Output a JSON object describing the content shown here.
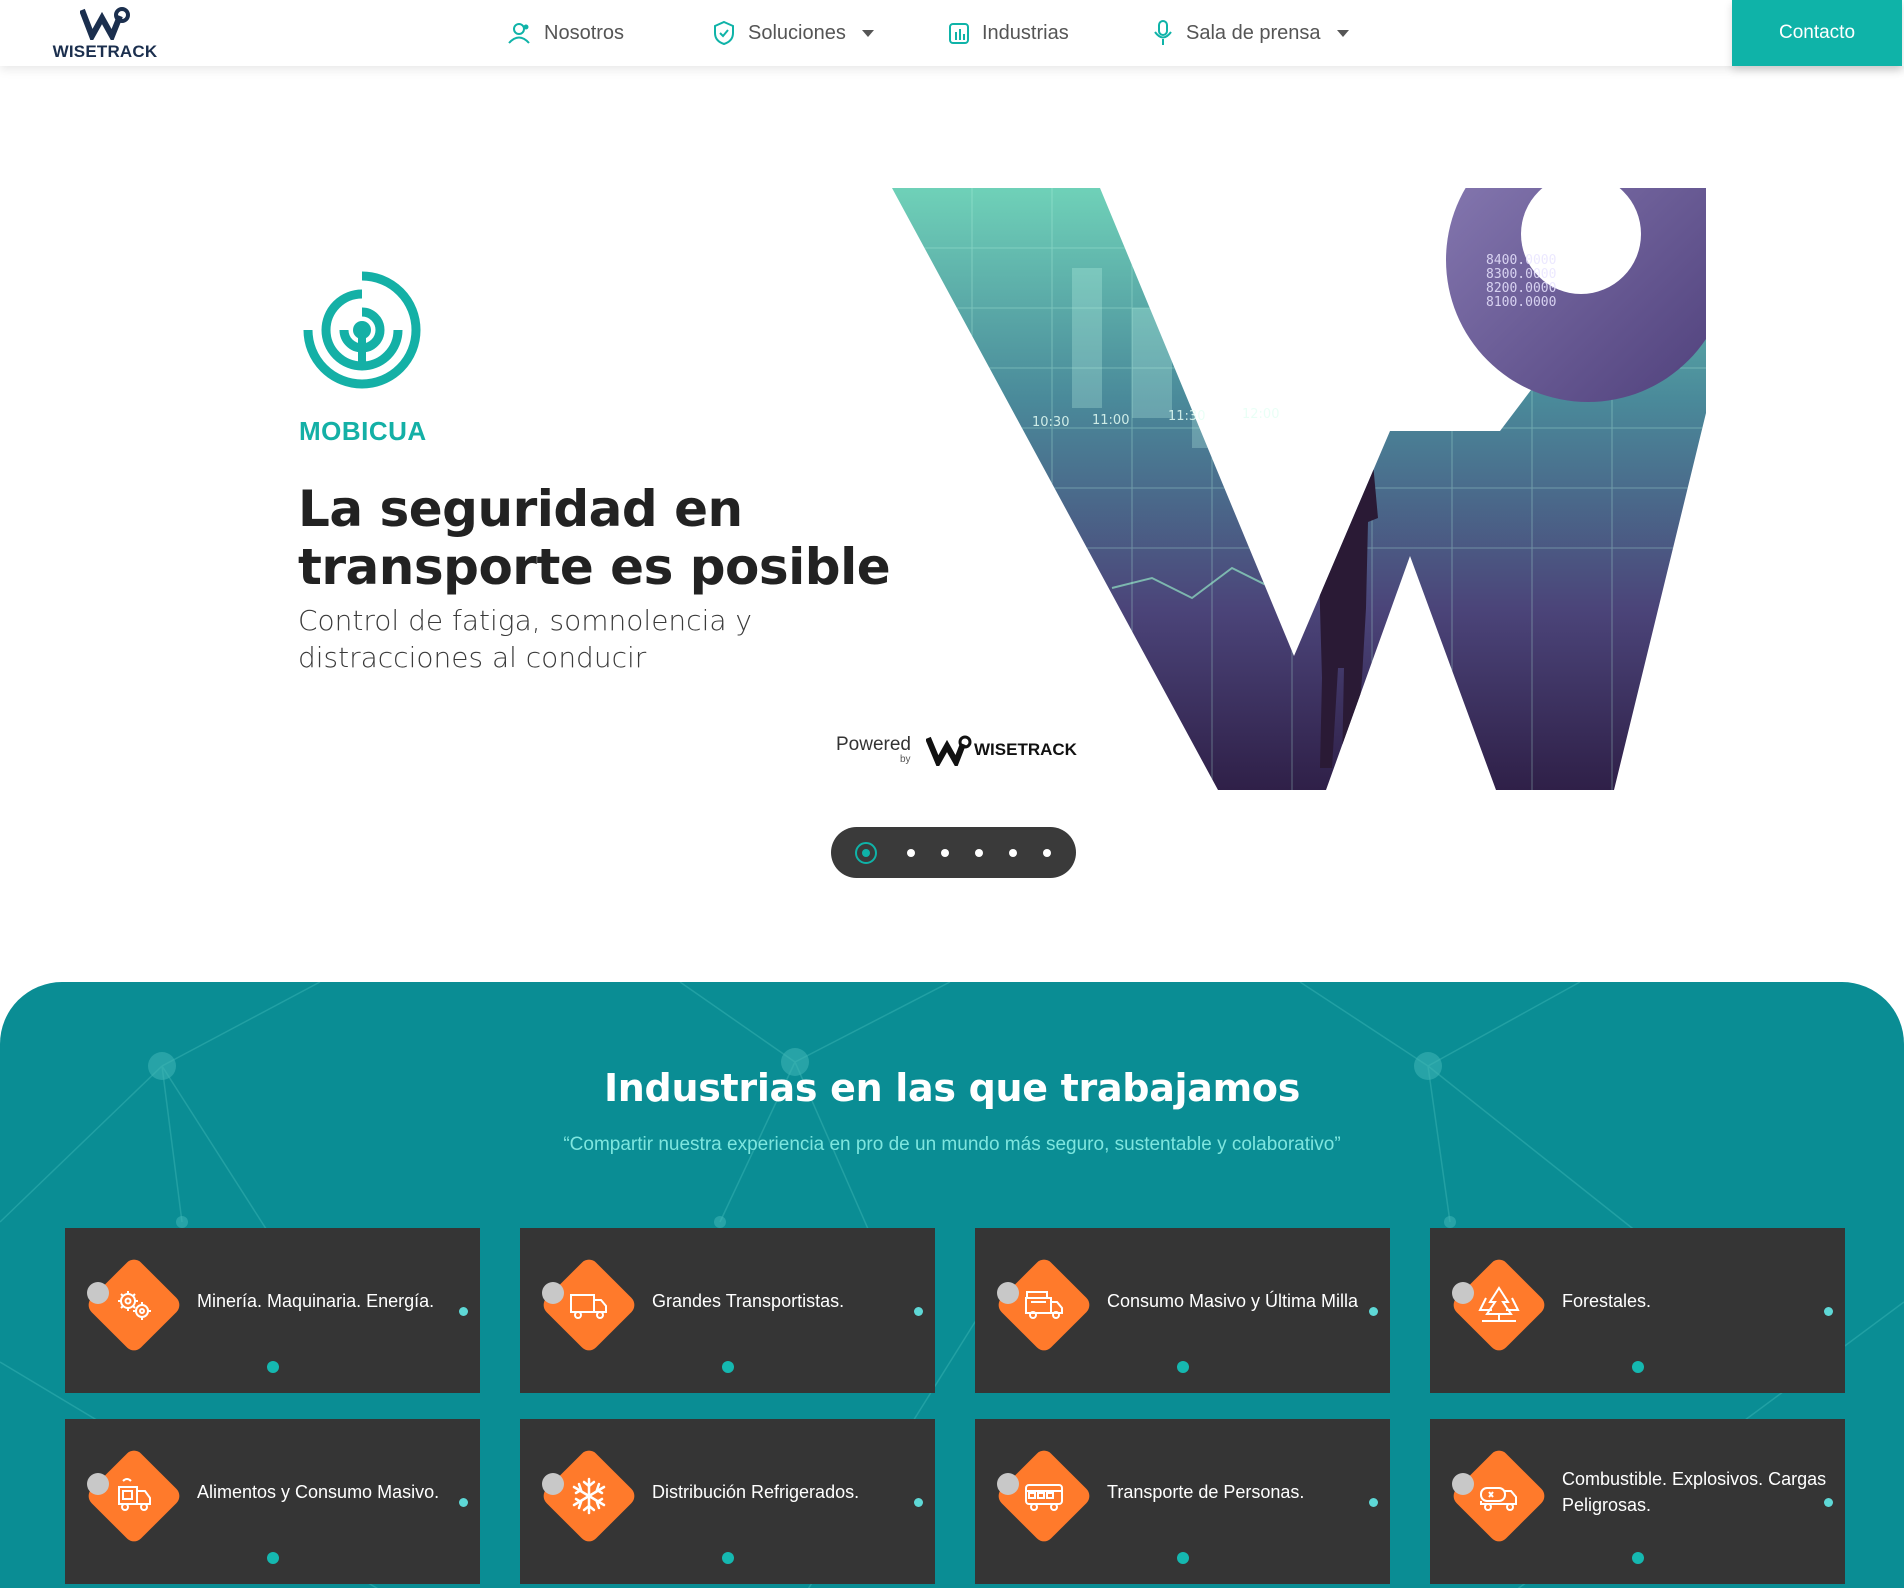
{
  "header": {
    "logo_text": "WISETRACK",
    "nav": [
      {
        "label": "Nosotros",
        "icon": "people-icon",
        "dropdown": false
      },
      {
        "label": "Soluciones",
        "icon": "shield-check-icon",
        "dropdown": true
      },
      {
        "label": "Industrias",
        "icon": "bar-chart-icon",
        "dropdown": false
      },
      {
        "label": "Sala de prensa",
        "icon": "microphone-icon",
        "dropdown": true
      }
    ],
    "contact_label": "Contacto"
  },
  "hero": {
    "brand_name": "MOBICUA",
    "title": "La seguridad en transporte es posible",
    "subtitle": "Control de fatiga, somnolencia y distracciones al conducir",
    "powered_label": "Powered",
    "powered_by": "by",
    "powered_brand": "WISETRACK",
    "image_readouts": [
      "8400.0000",
      "8300.0000",
      "8200.0000",
      "8100.0000",
      "10:30",
      "11:00",
      "11:30",
      "12:00"
    ],
    "slides_total": 6,
    "active_slide": 1
  },
  "industries": {
    "title": "Industrias en las que trabajamos",
    "subtitle": "“Compartir nuestra experiencia en pro de un mundo más seguro, sustentable y colaborativo”",
    "cards": [
      {
        "label": "Minería. Maquinaria. Energía.",
        "icon": "gears-icon"
      },
      {
        "label": "Grandes Transportistas.",
        "icon": "truck-icon"
      },
      {
        "label": "Consumo Masivo y Última Milla",
        "icon": "delivery-van-icon"
      },
      {
        "label": "Forestales.",
        "icon": "trees-icon"
      },
      {
        "label": "Alimentos y Consumo Masivo.",
        "icon": "food-truck-icon"
      },
      {
        "label": "Distribución Refrigerados.",
        "icon": "snowflake-icon"
      },
      {
        "label": "Transporte de Personas.",
        "icon": "bus-icon"
      },
      {
        "label": "Combustible. Explosivos. Cargas Peligrosas.",
        "icon": "tanker-truck-icon"
      }
    ]
  },
  "colors": {
    "accent": "#0fb3a8",
    "section_bg": "#0a8d94",
    "card_bg": "#353535",
    "icon_bg": "#ff7a2b"
  }
}
